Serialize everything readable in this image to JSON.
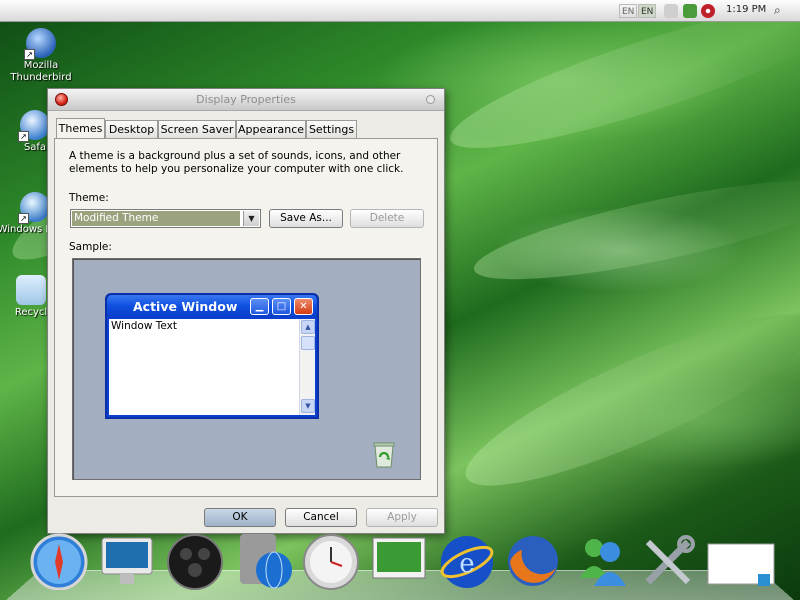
{
  "menubar": {
    "apple_glyph": "",
    "lang_inactive": "EN",
    "lang_active": "EN",
    "clock": "1:19 PM",
    "search_glyph": "⌕"
  },
  "desktop_icons": [
    {
      "label": "Mozilla Thunderbird",
      "icon": "thunderbird-icon"
    },
    {
      "label": "Safa",
      "icon": "safari-icon"
    },
    {
      "label": "Windows Playe",
      "icon": "windows-media-player-icon"
    },
    {
      "label": "Recycl",
      "icon": "recycle-bin-icon"
    }
  ],
  "dialog": {
    "title": "Display Properties",
    "tabs": [
      "Themes",
      "Desktop",
      "Screen Saver",
      "Appearance",
      "Settings"
    ],
    "description": "A theme is a background plus a set of sounds, icons, and other elements to help you personalize your computer with one click.",
    "theme_label": "Theme:",
    "theme_value": "Modified Theme",
    "save_as": "Save As...",
    "delete": "Delete",
    "sample_label": "Sample:",
    "sample": {
      "window_title": "Active Window",
      "window_text": "Window Text"
    },
    "ok": "OK",
    "cancel": "Cancel",
    "apply": "Apply"
  },
  "dock": [
    "safari-compass-icon",
    "imac-display-icon",
    "dashboard-icon",
    "network-globe-icon",
    "clock-icon",
    "desktop-screen-icon",
    "internet-explorer-icon",
    "firefox-icon",
    "messenger-icon",
    "system-tools-icon",
    "note-window-icon"
  ],
  "colors": {
    "titlebar_close": "#d8281c",
    "selected_theme_bg": "#9aa37d",
    "active_window_blue": "#0a3fd0",
    "sample_bg": "#a3afc0"
  }
}
